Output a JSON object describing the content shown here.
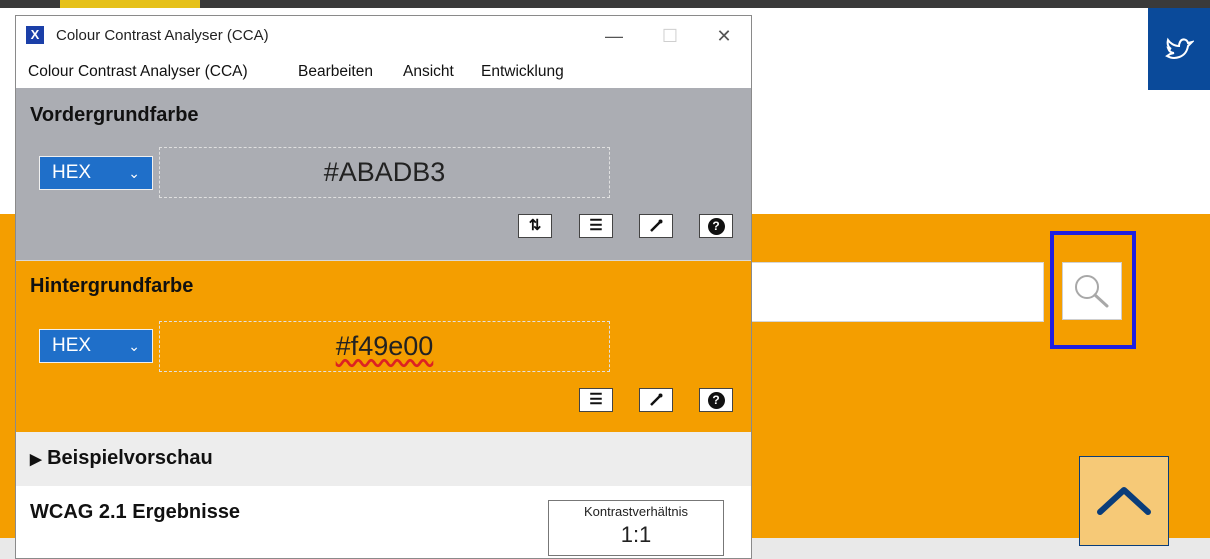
{
  "window": {
    "title": "Colour Contrast Analyser (CCA)",
    "icon_letter": "X",
    "minimize": "—",
    "maximize": "☐",
    "close": "✕"
  },
  "menu": [
    "Colour Contrast Analyser (CCA)",
    "Bearbeiten",
    "Ansicht",
    "Entwicklung"
  ],
  "foreground": {
    "title": "Vordergrundfarbe",
    "format": "HEX",
    "value": "#ABADB3",
    "color": "#abadb3"
  },
  "background": {
    "title": "Hintergrundfarbe",
    "format": "HEX",
    "value": "#f49e00",
    "color": "#f49e00"
  },
  "preview": {
    "label": "Beispielvorschau"
  },
  "results": {
    "title": "WCAG 2.1 Ergebnisse",
    "ratio_label": "Kontrastverhältnis",
    "ratio_value": "1:1"
  },
  "colors": {
    "accent_blue": "#1f6fc9",
    "highlight": "#1f1fe0",
    "site_orange": "#f49e00",
    "site_blue": "#0a4a9a"
  }
}
